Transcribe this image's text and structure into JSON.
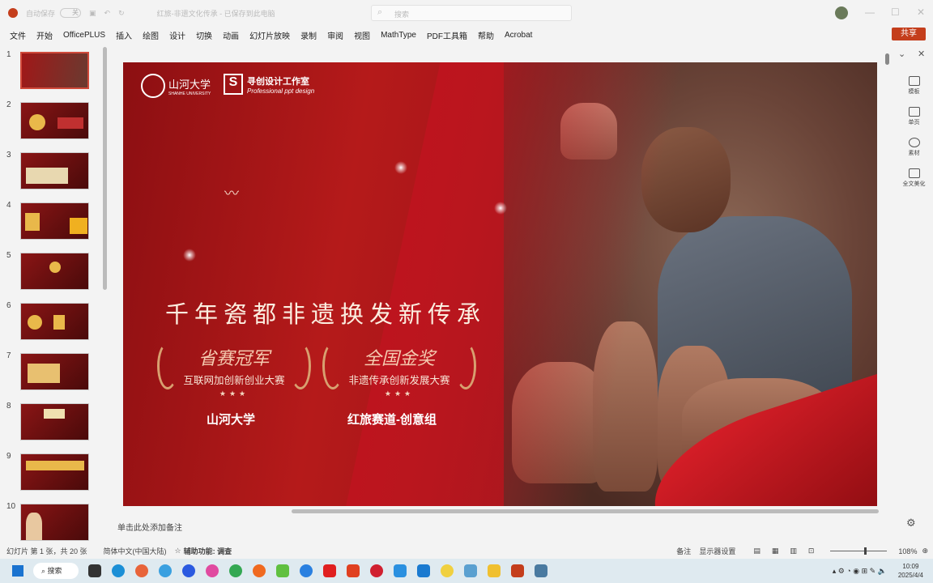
{
  "titlebar": {
    "autosave_label": "自动保存",
    "autosave_state": "关",
    "filename": "红旅-非遗文化传承 - 已保存到此电脑",
    "search_placeholder": "搜索"
  },
  "menu": [
    "文件",
    "开始",
    "OfficePLUS",
    "插入",
    "绘图",
    "设计",
    "切换",
    "动画",
    "幻灯片放映",
    "录制",
    "审阅",
    "视图",
    "MathType",
    "PDF工具箱",
    "帮助",
    "Acrobat"
  ],
  "share_label": "共享",
  "thumbnails": [
    "1",
    "2",
    "3",
    "4",
    "5",
    "6",
    "7",
    "8",
    "9",
    "10"
  ],
  "slide": {
    "logo_university": "山河大学",
    "logo_university_en": "SHANHE UNIVERSITY",
    "logo_studio": "寻创设计工作室",
    "logo_studio_en": "Professional ppt design",
    "title": "千年瓷都非遗换发新传承",
    "awards": [
      {
        "title": "省赛冠军",
        "subtitle": "互联网加创新创业大赛",
        "stars": "★★★"
      },
      {
        "title": "全国金奖",
        "subtitle": "非遗传承创新发展大赛",
        "stars": "★★★"
      }
    ],
    "captions": [
      "山河大学",
      "红旅赛道-创意组"
    ]
  },
  "notes_placeholder": "单击此处添加备注",
  "right_panel": [
    "模板",
    "单页",
    "素材",
    "全文美化"
  ],
  "status": {
    "slide_info": "幻灯片 第 1 张，共 20 张",
    "language": "简体中文(中国大陆)",
    "accessibility": "辅助功能: 调查",
    "notes": "备注",
    "display": "显示器设置",
    "zoom": "108%"
  },
  "taskbar": {
    "search": "搜索",
    "time": "10:09",
    "date": "2025/4/4"
  }
}
